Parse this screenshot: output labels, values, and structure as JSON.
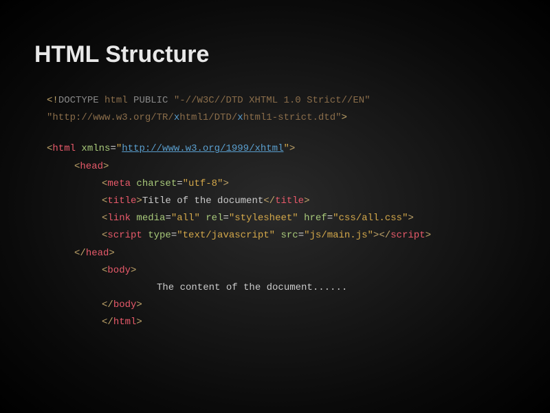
{
  "title": "HTML Structure",
  "code": {
    "doctype_open": "<!",
    "doctype_kw": "DOCTYPE",
    "doctype_html": " html ",
    "doctype_public": "PUBLIC",
    "doctype_fpi": " \"-//W3C//DTD XHTML 1.0 Strict//EN\"",
    "dtd_q1": "\"http://www.w3.org/TR/",
    "dtd_x": "x",
    "dtd_mid": "html1/DTD/",
    "dtd_x2": "x",
    "dtd_end": "html1-strict.dtd\"",
    "gt": ">",
    "lt": "<",
    "html_tag": "html",
    "xmlns": " xmlns",
    "xmlns_url": "http://www.w3.org/1999/xhtml",
    "q": "\"",
    "head_open": "head",
    "meta": "meta",
    "charset": " charset",
    "utf8": "\"utf-8\"",
    "title_tag": "title",
    "title_text": "Title of the document",
    "title_close": "title",
    "link": "link",
    "media": " media",
    "all": "\"all\"",
    "rel": " rel",
    "stylesheet": "\"stylesheet\"",
    "href": " href",
    "css": "\"css/all.css\"",
    "script": "script",
    "type": " type",
    "textjs": "\"text/javascript\"",
    "src": " src",
    "jsmain": "\"js/main.js\"",
    "head_close": "head",
    "body_tag": "body",
    "body_text": "The content of the document......",
    "body_close": "body",
    "html_close": "html",
    "slash": "/",
    "eq": "="
  }
}
